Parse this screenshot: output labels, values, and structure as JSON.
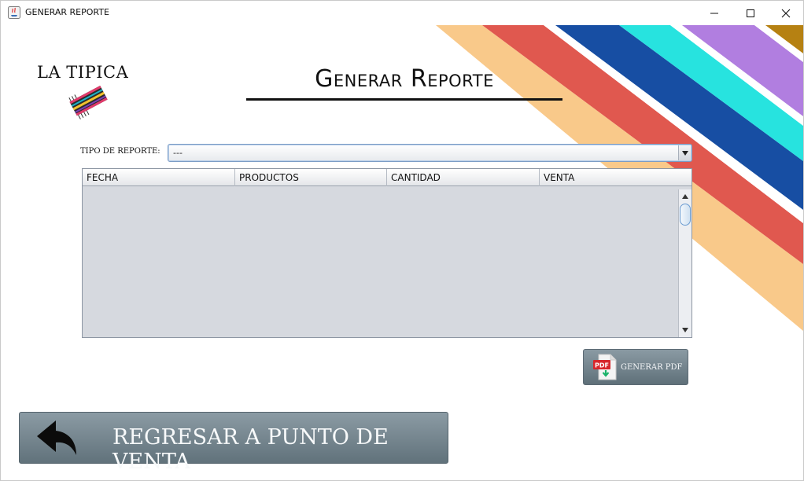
{
  "window": {
    "title": "GENERAR REPORTE"
  },
  "logo": {
    "text": "LA TIPICA"
  },
  "header": {
    "title": "Generar Reporte"
  },
  "report_type": {
    "label": "TIPO DE REPORTE:",
    "selected": "---"
  },
  "table": {
    "columns": [
      "FECHA",
      "PRODUCTOS",
      "CANTIDAD",
      "VENTA"
    ],
    "rows": []
  },
  "buttons": {
    "generate_pdf": "GENERAR PDF",
    "pdf_badge": "PDF",
    "back": "REGRESAR A PUNTO DE VENTA"
  },
  "colors": {
    "stripe_orange": "#f9c98a",
    "stripe_red": "#e0584f",
    "stripe_navy": "#174ea3",
    "stripe_cyan": "#27e3df",
    "stripe_purple": "#b17ee0",
    "stripe_gold": "#b68112",
    "button_gray": "#6b7c85"
  }
}
